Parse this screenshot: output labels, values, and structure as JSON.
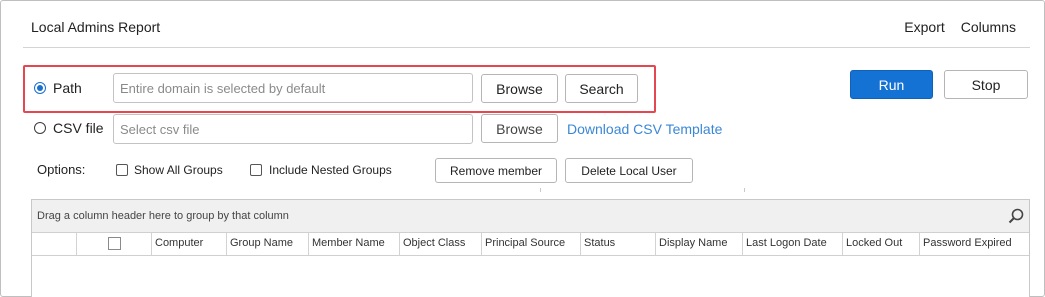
{
  "header": {
    "title": "Local Admins Report",
    "export_label": "Export",
    "columns_label": "Columns"
  },
  "source": {
    "path_label": "Path",
    "path_selected": true,
    "path_placeholder": "Entire domain is selected by default",
    "browse_label": "Browse",
    "search_label": "Search",
    "csv_label": "CSV file",
    "csv_placeholder": "Select csv file",
    "csv_browse_label": "Browse",
    "download_template_label": "Download CSV Template"
  },
  "actions": {
    "run_label": "Run",
    "stop_label": "Stop"
  },
  "options": {
    "label": "Options:",
    "show_all_groups_label": "Show All Groups",
    "show_all_groups_checked": false,
    "include_nested_label": "Include Nested Groups",
    "include_nested_checked": false,
    "remove_member_label": "Remove member",
    "delete_local_user_label": "Delete Local User"
  },
  "grid": {
    "group_panel_text": "Drag a column header here to group by that column",
    "columns": [
      "Computer",
      "Group Name",
      "Member Name",
      "Object Class",
      "Principal Source",
      "Status",
      "Display Name",
      "Last Logon Date",
      "Locked Out",
      "Password Expired"
    ]
  },
  "colors": {
    "accent": "#1472d4",
    "highlight": "#e4474f",
    "link": "#3a87d6"
  }
}
